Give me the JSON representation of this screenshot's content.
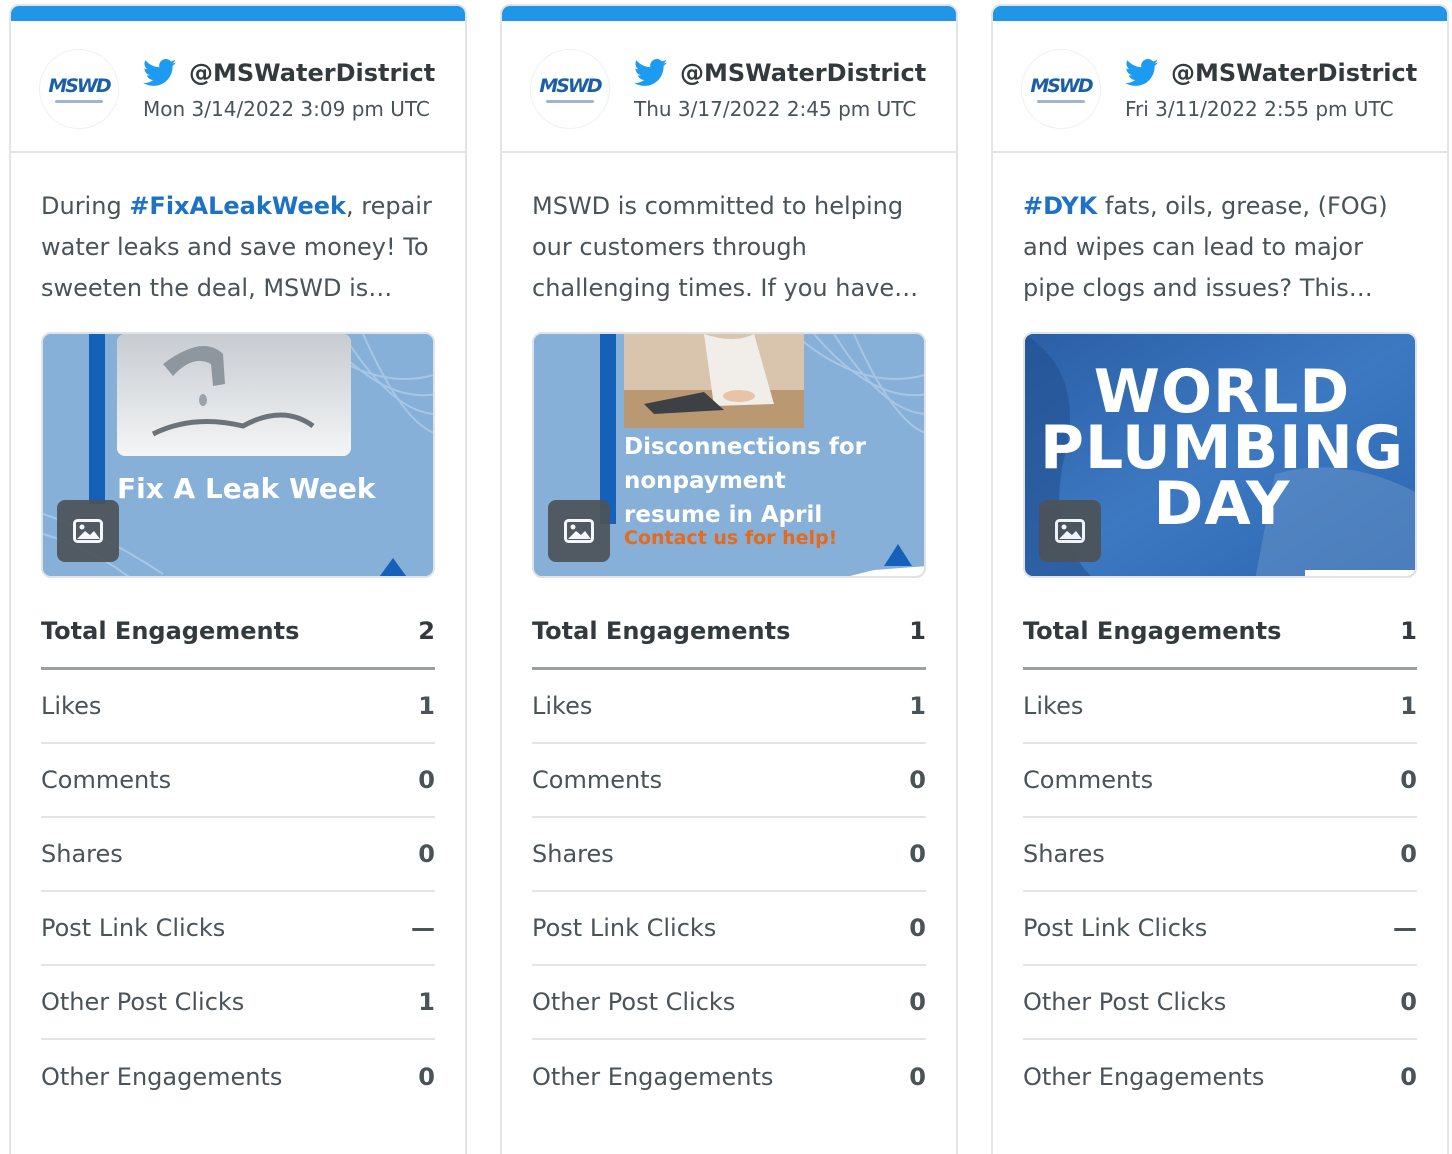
{
  "colors": {
    "accent": "#2196e8",
    "hashtag": "#1d72c6",
    "twitter": "#1d9bf0"
  },
  "cards": [
    {
      "handle": "@MSWaterDistrict",
      "date": "Mon 3/14/2022 3:09 pm UTC",
      "text_pre": "During ",
      "hashtag": "#FixALeakWeek",
      "text_post": ", repair water leaks and save money! To sweeten the deal, MSWD is offering free leak detection kits",
      "media_caption": "Fix A Leak Week",
      "media_caption2": "",
      "media_caption3": "",
      "media_caption4": "",
      "total_label": "Total Engagements",
      "total_value": "2",
      "stats": [
        {
          "label": "Likes",
          "value": "1"
        },
        {
          "label": "Comments",
          "value": "0"
        },
        {
          "label": "Shares",
          "value": "0"
        },
        {
          "label": "Post Link Clicks",
          "value": "—"
        },
        {
          "label": "Other Post Clicks",
          "value": "1"
        },
        {
          "label": "Other Engagements",
          "value": "0"
        }
      ]
    },
    {
      "handle": "@MSWaterDistrict",
      "date": "Thu 3/17/2022 2:45 pm UTC",
      "text_pre": "MSWD is committed to helping our customers through challenging times. If you have an outstanding balance",
      "hashtag": "",
      "text_post": "",
      "media_caption": "Disconnections for",
      "media_caption2": "nonpayment",
      "media_caption3": "resume in April",
      "media_caption4": "Contact us for help!",
      "total_label": "Total Engagements",
      "total_value": "1",
      "stats": [
        {
          "label": "Likes",
          "value": "1"
        },
        {
          "label": "Comments",
          "value": "0"
        },
        {
          "label": "Shares",
          "value": "0"
        },
        {
          "label": "Post Link Clicks",
          "value": "0"
        },
        {
          "label": "Other Post Clicks",
          "value": "0"
        },
        {
          "label": "Other Engagements",
          "value": "0"
        }
      ]
    },
    {
      "handle": "@MSWaterDistrict",
      "date": "Fri 3/11/2022 2:55 pm UTC",
      "text_pre": "",
      "hashtag": "#DYK",
      "text_post": " fats, oils, grease, (FOG) and wipes can lead to major pipe clogs and issues? This World Plumbing Day",
      "media_caption": "WORLD",
      "media_caption2": "PLUMBING",
      "media_caption3": "DAY",
      "media_caption4": "",
      "total_label": "Total Engagements",
      "total_value": "1",
      "stats": [
        {
          "label": "Likes",
          "value": "1"
        },
        {
          "label": "Comments",
          "value": "0"
        },
        {
          "label": "Shares",
          "value": "0"
        },
        {
          "label": "Post Link Clicks",
          "value": "—"
        },
        {
          "label": "Other Post Clicks",
          "value": "0"
        },
        {
          "label": "Other Engagements",
          "value": "0"
        }
      ]
    }
  ]
}
